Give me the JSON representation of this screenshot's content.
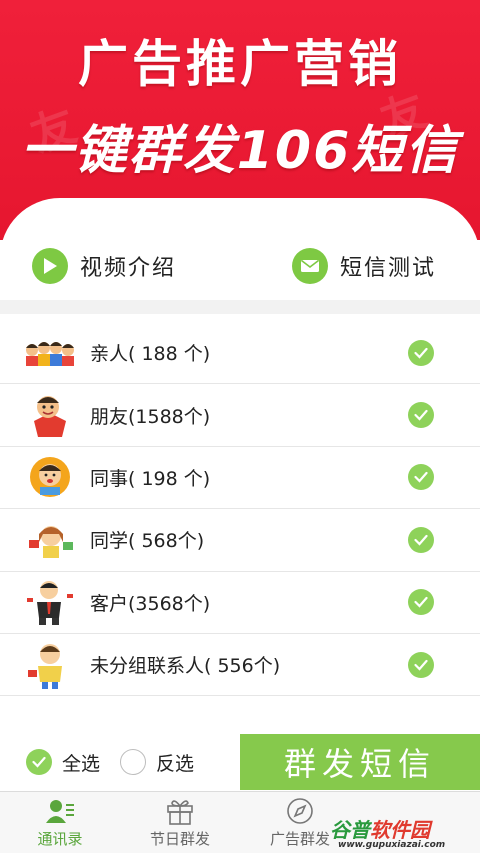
{
  "hero": {
    "line1": "广告推广营销",
    "line2": "一键群发106短信"
  },
  "features": [
    {
      "label": "视频介绍",
      "icon": "play-icon"
    },
    {
      "label": "短信测试",
      "icon": "mail-icon"
    }
  ],
  "groups": [
    {
      "label": "亲人( 188 个)",
      "avatar": "family-group-avatar",
      "selected": true
    },
    {
      "label": "朋友(1588个)",
      "avatar": "friend-avatar",
      "selected": true
    },
    {
      "label": "同事( 198 个)",
      "avatar": "colleague-avatar",
      "selected": true
    },
    {
      "label": "同学(  568个)",
      "avatar": "classmate-avatar",
      "selected": true
    },
    {
      "label": "客户(3568个)",
      "avatar": "client-avatar",
      "selected": true
    },
    {
      "label": "未分组联系人( 556个)",
      "avatar": "ungrouped-avatar",
      "selected": true
    }
  ],
  "bottom": {
    "select_all": "全选",
    "invert": "反选",
    "send": "群发短信"
  },
  "tabs": [
    {
      "label": "通讯录",
      "icon": "contacts-icon",
      "active": true
    },
    {
      "label": "节日群发",
      "icon": "gift-icon",
      "active": false
    },
    {
      "label": "广告群发",
      "icon": "compass-icon",
      "active": false
    }
  ],
  "watermark": {
    "brand_a": "谷普",
    "brand_b": "软件园",
    "url": "www.gupuxiazai.com"
  },
  "colors": {
    "hero_red": "#e6162f",
    "accent_green": "#86c94c",
    "check_green": "#8ed25a"
  }
}
